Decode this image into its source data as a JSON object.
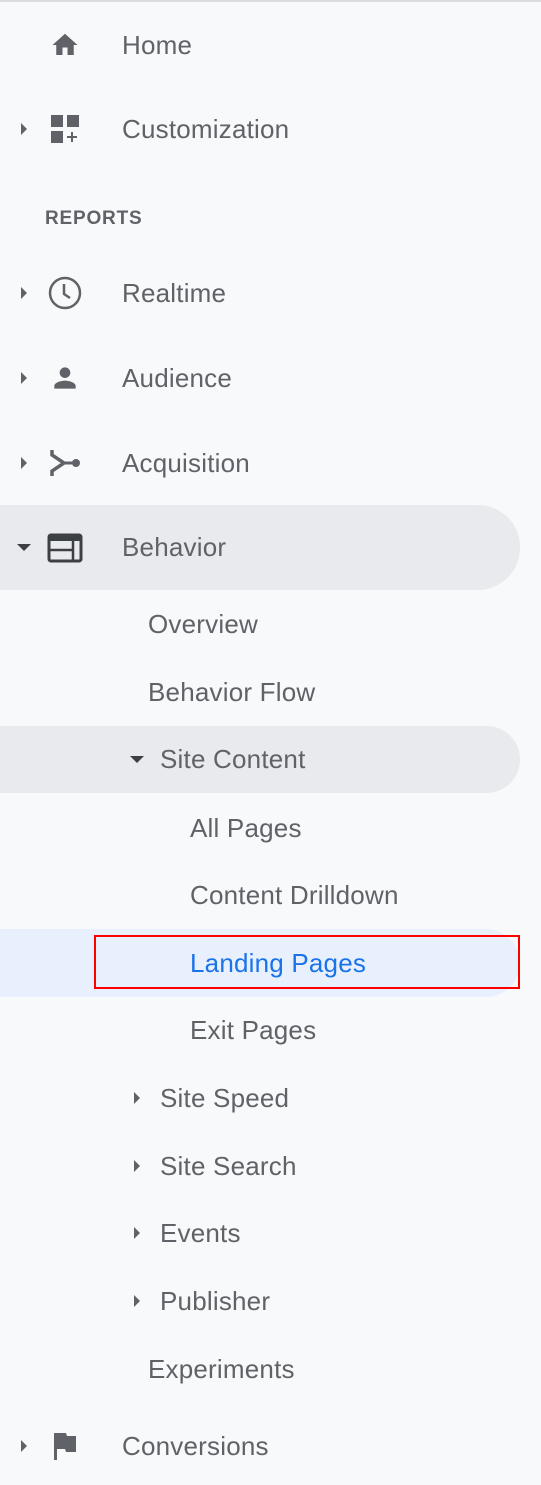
{
  "nav": {
    "home": {
      "label": "Home",
      "icon": "home-icon"
    },
    "customization": {
      "label": "Customization",
      "icon": "dashboard-add-icon",
      "expanded": false
    },
    "section_label": "REPORTS",
    "realtime": {
      "label": "Realtime",
      "icon": "clock-icon",
      "expanded": false
    },
    "audience": {
      "label": "Audience",
      "icon": "person-icon",
      "expanded": false
    },
    "acquisition": {
      "label": "Acquisition",
      "icon": "merge-icon",
      "expanded": false
    },
    "behavior": {
      "label": "Behavior",
      "icon": "web-layout-icon",
      "expanded": true,
      "children": {
        "overview": "Overview",
        "behavior_flow": "Behavior Flow",
        "site_content": {
          "label": "Site Content",
          "expanded": true,
          "children": {
            "all_pages": "All Pages",
            "content_drilldown": "Content Drilldown",
            "landing_pages": "Landing Pages",
            "exit_pages": "Exit Pages"
          }
        },
        "site_speed": "Site Speed",
        "site_search": "Site Search",
        "events": "Events",
        "publisher": "Publisher",
        "experiments": "Experiments"
      }
    },
    "conversions": {
      "label": "Conversions",
      "icon": "flag-icon",
      "expanded": false
    }
  },
  "selected_item": "Landing Pages",
  "colors": {
    "background": "#f8f9fa",
    "text": "#5f6368",
    "active_text": "#1a73e8",
    "active_bg": "#e8f0fe",
    "expanded_bg": "#e8eaed",
    "highlight_box": "#ff0000"
  }
}
